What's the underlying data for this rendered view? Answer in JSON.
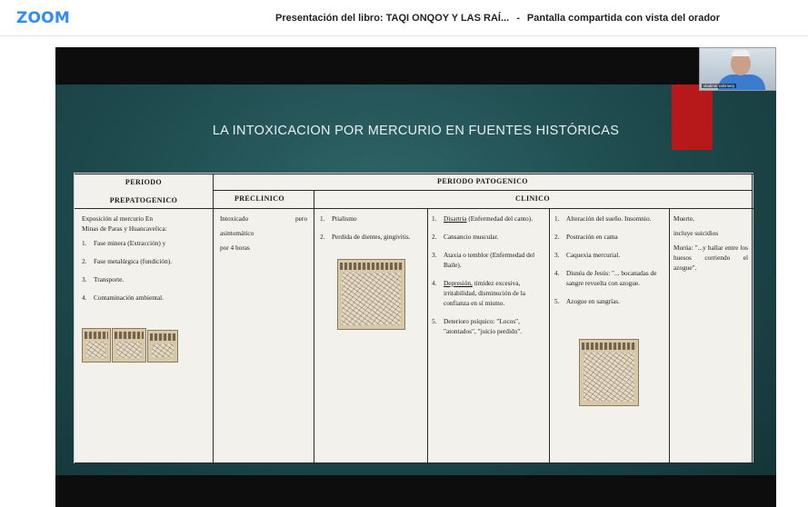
{
  "app": {
    "logo": "ZOOM",
    "title_main": "Presentación del libro: TAQI ONQOY Y LAS RAÍ...",
    "title_sep": "-",
    "title_rest": "Pantalla compartida con vista del orador",
    "accent_color": "#2d8cff"
  },
  "slide": {
    "title": "LA INTOXICACION POR MERCURIO EN FUENTES HISTÓRICAS",
    "accent_color": "#b7191a"
  },
  "participant": {
    "name": "vladimir rahimery"
  },
  "table": {
    "col1_header_line1": "PERIODO",
    "col1_header_line2": "PREPATOGENICO",
    "pat_header": "PERIODO PATOGENICO",
    "preclinico_header": "PRECLINICO",
    "clinico_header": "CLINICO",
    "prepat": {
      "intro_a": "Exposición al mercurio En",
      "intro_b": "Minas de Paras y Huancavelica:",
      "items": [
        {
          "n": "1.",
          "t": "Fase minera (Extracción) y"
        },
        {
          "n": "2.",
          "t": "Fase metalúrgica (fundición)."
        },
        {
          "n": "3.",
          "t": "Transporte."
        },
        {
          "n": "4.",
          "t": "Contaminación ambiental."
        }
      ]
    },
    "preclinico": {
      "l1a": "Intoxicado",
      "l1b": "pero",
      "l2": "asintomático",
      "l3": "por 4 horas"
    },
    "clin_a": [
      {
        "n": "1.",
        "t": "Ptialismo"
      },
      {
        "n": "2.",
        "t": "Perdida de dientes, gingivitis."
      }
    ],
    "clin_b": [
      {
        "n": "1.",
        "t_u": "Disartria",
        "t": " (Enfermedad del canto)."
      },
      {
        "n": "2.",
        "t": "Cansancio muscular."
      },
      {
        "n": "3.",
        "t": "Ataxia o temblor (Enfermedad del Baile)."
      },
      {
        "n": "4.",
        "t_u": "Depresión,",
        "t": " timidez excesiva, irritabilidad, disminución de la confianza en sí mismo."
      },
      {
        "n": "5.",
        "t": "Deterioro psíquico: \"Locos\", \"atontados\", \"juicio perdido\"."
      }
    ],
    "clin_c": [
      {
        "n": "1.",
        "t": "Alteración del sueño. Insomnio."
      },
      {
        "n": "2.",
        "t": "Postración en cama"
      },
      {
        "n": "3.",
        "t": "Caquexia mercurial."
      },
      {
        "n": "4.",
        "t": "Disnéa de Jesús: \"... bocanadas de sangre revuelta con azogue."
      },
      {
        "n": "5.",
        "t": "Azogue en sangrías."
      }
    ],
    "clin_d": {
      "l1": "Muerte,",
      "l2": "incluye suicidios",
      "l3": "Murúa: \"...y hallar entre los huesos corriendo el azogue\"."
    }
  }
}
